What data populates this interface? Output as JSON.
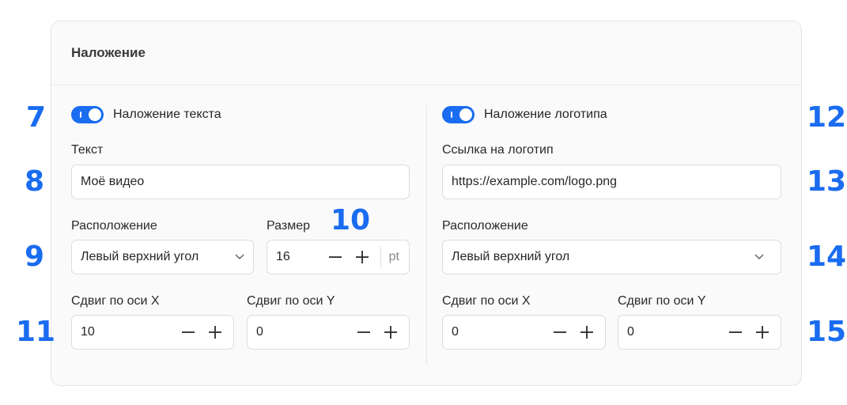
{
  "card": {
    "title": "Наложение"
  },
  "text_overlay": {
    "toggle_label": "Наложение текста",
    "text_label": "Текст",
    "text_value": "Моё видео",
    "position_label": "Расположение",
    "position_value": "Левый верхний угол",
    "size_label": "Размер",
    "size_value": "16",
    "size_unit": "pt",
    "offset_x_label": "Сдвиг по оси X",
    "offset_x_value": "10",
    "offset_y_label": "Сдвиг по оси Y",
    "offset_y_value": "0"
  },
  "logo_overlay": {
    "toggle_label": "Наложение логотипа",
    "url_label": "Ссылка на логотип",
    "url_value": "https://example.com/logo.png",
    "position_label": "Расположение",
    "position_value": "Левый верхний угол",
    "offset_x_label": "Сдвиг по оси X",
    "offset_x_value": "0",
    "offset_y_label": "Сдвиг по оси Y",
    "offset_y_value": "0"
  },
  "markers": [
    "7",
    "8",
    "9",
    "10",
    "11",
    "12",
    "13",
    "14",
    "15"
  ],
  "colors": {
    "accent": "#1a6cf0",
    "border": "#dcdcdc",
    "card_bg": "#fafafa"
  }
}
